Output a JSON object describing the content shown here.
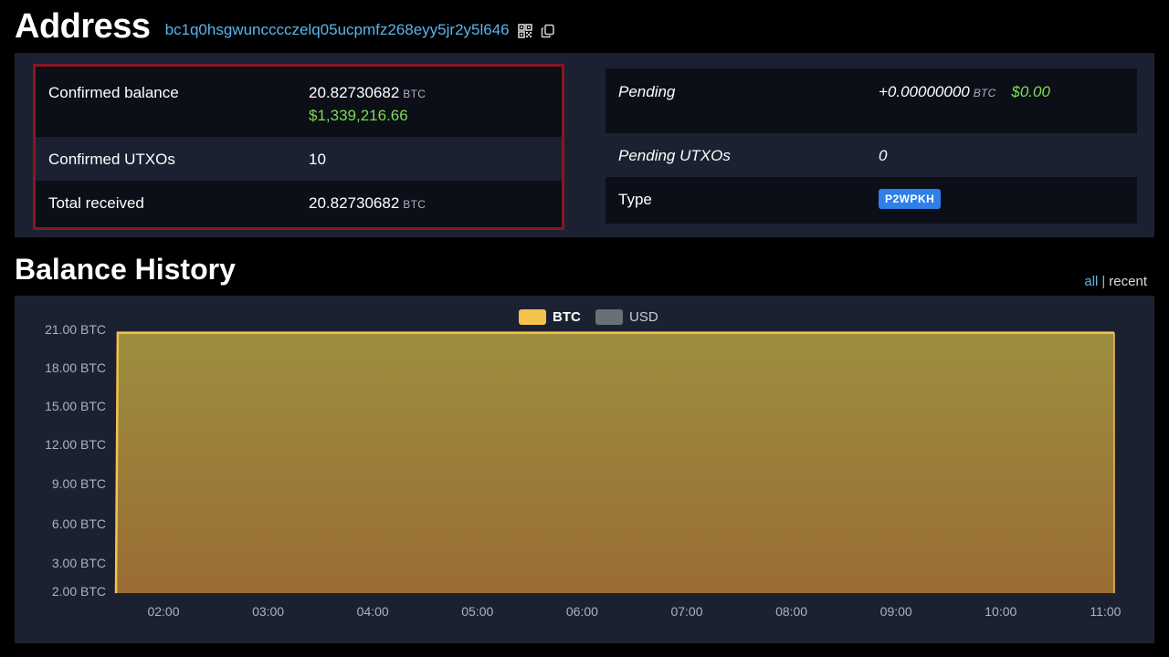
{
  "header": {
    "title": "Address",
    "address": "bc1q0hsgwuncccczelq05ucpmfz268eyy5jr2y5l646",
    "qr_icon": "qr-code-icon",
    "copy_icon": "copy-icon"
  },
  "summary_left": {
    "confirmed_balance_label": "Confirmed balance",
    "confirmed_balance_btc": "20.82730682",
    "confirmed_balance_unit": "BTC",
    "confirmed_balance_usd": "$1,339,216.66",
    "confirmed_utxos_label": "Confirmed UTXOs",
    "confirmed_utxos_value": "10",
    "total_received_label": "Total received",
    "total_received_btc": "20.82730682",
    "total_received_unit": "BTC"
  },
  "summary_right": {
    "pending_label": "Pending",
    "pending_btc": "+0.00000000",
    "pending_unit": "BTC",
    "pending_usd": "$0.00",
    "pending_utxos_label": "Pending UTXOs",
    "pending_utxos_value": "0",
    "type_label": "Type",
    "type_value": "P2WPKH"
  },
  "history": {
    "title": "Balance History",
    "link_all": "all",
    "link_separator": "|",
    "link_recent": "recent"
  },
  "colors": {
    "accent_link": "#5bb4ee",
    "usd_green": "#7ddc4f",
    "highlight_border": "#8a1522",
    "badge_blue": "#2f7fe8",
    "btc_series": "#f5c24c",
    "usd_series": "#6b6f78"
  },
  "chart_data": {
    "type": "area",
    "legend": [
      {
        "name": "BTC",
        "color": "#f5c24c"
      },
      {
        "name": "USD",
        "color": "#6b6f78"
      }
    ],
    "y_tick_labels": [
      "21.00 BTC",
      "18.00 BTC",
      "15.00 BTC",
      "12.00 BTC",
      "9.00 BTC",
      "6.00 BTC",
      "3.00 BTC",
      "2.00 BTC"
    ],
    "x_tick_labels": [
      "02:00",
      "03:00",
      "04:00",
      "05:00",
      "06:00",
      "07:00",
      "08:00",
      "09:00",
      "10:00",
      "11:00"
    ],
    "ylim": [
      2,
      21
    ],
    "series": [
      {
        "name": "BTC",
        "x": [
          "01:32",
          "01:33",
          "11:08"
        ],
        "values": [
          2.0,
          20.827,
          20.827
        ]
      }
    ],
    "legend_position": "top-center",
    "grid": false
  }
}
